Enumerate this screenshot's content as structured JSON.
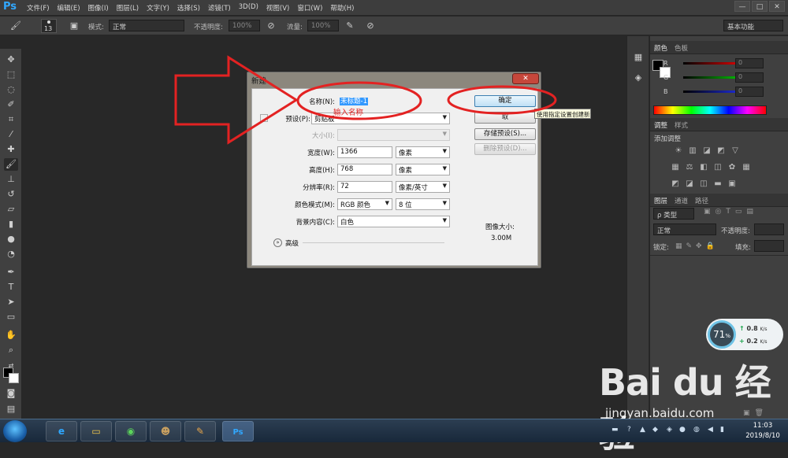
{
  "app": {
    "logo": "Ps",
    "menu": [
      "文件(F)",
      "编辑(E)",
      "图像(I)",
      "图层(L)",
      "文字(Y)",
      "选择(S)",
      "滤镜(T)",
      "3D(D)",
      "视图(V)",
      "窗口(W)",
      "帮助(H)"
    ],
    "window_controls": [
      "—",
      "□",
      "✕"
    ]
  },
  "options_bar": {
    "brush_size": "13",
    "mode_label": "模式:",
    "mode_value": "正常",
    "opacity_label": "不透明度:",
    "opacity_value": "100%",
    "flow_label": "流量:",
    "flow_value": "100%",
    "workspace": "基本功能"
  },
  "panels": {
    "color_tabs": [
      "颜色",
      "色板"
    ],
    "channels": [
      {
        "label": "R",
        "value": "0",
        "color": "#ff2020"
      },
      {
        "label": "G",
        "value": "0",
        "color": "#20d020"
      },
      {
        "label": "B",
        "value": "0",
        "color": "#2040ff"
      }
    ],
    "adjust_tabs": [
      "调整",
      "样式"
    ],
    "adjust_title": "添加调整",
    "layers_tabs": [
      "图层",
      "通道",
      "路径"
    ],
    "layers_filter": "ρ 类型",
    "blend_mode": "正常",
    "layer_opacity_label": "不透明度:",
    "lock_label": "锁定:",
    "fill_label": "填充:"
  },
  "dialog": {
    "title": "新建",
    "close": "✕",
    "name_label": "名称(N):",
    "name_value": "未标题-1",
    "preset_label": "预设(P):",
    "preset_value": "剪贴板",
    "size_label": "大小(I):",
    "width_label": "宽度(W):",
    "width_value": "1366",
    "width_unit": "像素",
    "height_label": "高度(H):",
    "height_value": "768",
    "height_unit": "像素",
    "resolution_label": "分辨率(R):",
    "resolution_value": "72",
    "resolution_unit": "像素/英寸",
    "color_mode_label": "颜色模式(M):",
    "color_mode_value": "RGB 颜色",
    "bit_depth": "8 位",
    "background_label": "背景内容(C):",
    "background_value": "白色",
    "advanced_label": "高级",
    "ok_button": "确定",
    "cancel_button_partial": "取",
    "save_preset_button": "存储预设(S)...",
    "delete_preset_button": "删除预设(D)...",
    "image_size_label": "图像大小:",
    "image_size_value": "3.00M",
    "tooltip": "使用指定设置创建新文档"
  },
  "annotation": {
    "text": "输入名称",
    "color": "#e02020"
  },
  "speed_widget": {
    "percent": "71",
    "percent_unit": "%",
    "upload": "0.8",
    "download": "0.2",
    "unit": "K/s"
  },
  "watermark": {
    "logo": "Bai du 经验",
    "url": "jingyan.baidu.com"
  },
  "taskbar": {
    "time": "11:03",
    "date": "2019/8/10"
  }
}
